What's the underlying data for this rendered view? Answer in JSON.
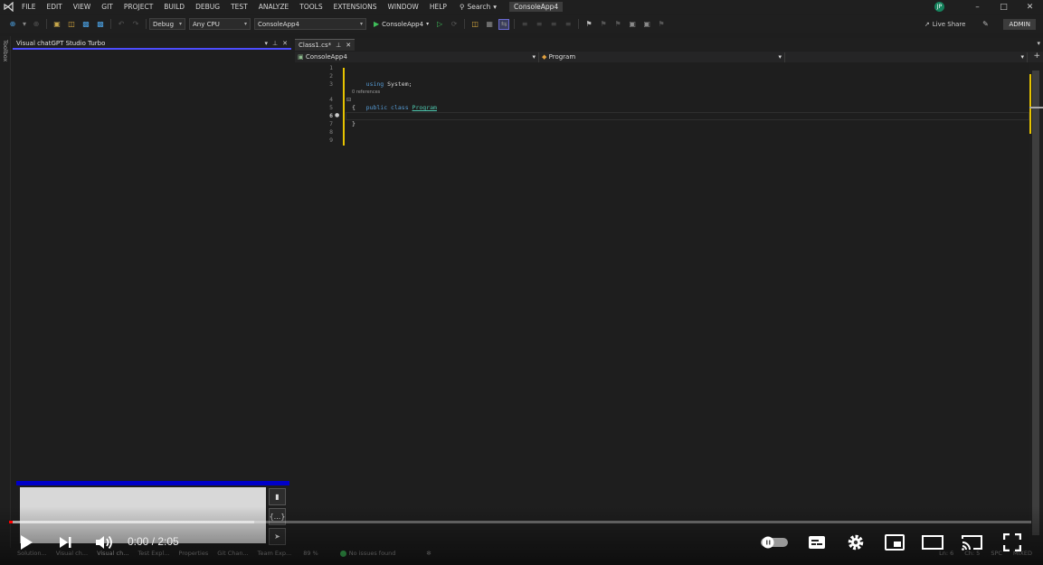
{
  "menu": {
    "items": [
      "FILE",
      "EDIT",
      "VIEW",
      "GIT",
      "PROJECT",
      "BUILD",
      "DEBUG",
      "TEST",
      "ANALYZE",
      "TOOLS",
      "EXTENSIONS",
      "WINDOW",
      "HELP"
    ],
    "search_label": "Search",
    "solution_title": "ConsoleApp4",
    "user_initials": "JP"
  },
  "toolbar": {
    "config": "Debug",
    "platform": "Any CPU",
    "project": "ConsoleApp4",
    "run_label": "ConsoleApp4",
    "live_share": "Live Share",
    "admin": "ADMIN"
  },
  "toolbox": {
    "label": "Toolbox"
  },
  "tool_window": {
    "title": "Visual chatGPT Studio Turbo",
    "buttons": {
      "delete": "trash-icon",
      "format": "ellipsis-icon",
      "send": "send-icon"
    }
  },
  "editor": {
    "tab_label": "Class1.cs*",
    "nav_project": "ConsoleApp4",
    "nav_member": "Program",
    "line_numbers": [
      "1",
      "2",
      "3",
      "4",
      "5",
      "6",
      "7",
      "8",
      "9"
    ],
    "current_line": "6",
    "codelens": "0 references",
    "code": {
      "using_kw": "using",
      "using_ns": " System;",
      "public_kw": "public",
      "class_kw": " class ",
      "class_name": "Program",
      "open_brace": "{",
      "close_brace": "}"
    }
  },
  "bottom_tabs": [
    "Solution...",
    "Visual ch...",
    "Visual ch...",
    "Test Expl...",
    "Properties",
    "Git Chan...",
    "Team Exp..."
  ],
  "status": {
    "zoom": "89 %",
    "issues": "No issues found",
    "line": "Ln: 6",
    "col": "Ch: 5",
    "spc": "SPC",
    "eol": "MIXED"
  },
  "video": {
    "time": "0:00 / 2:05",
    "progress_fraction": 0.003,
    "buffer_fraction": 0.24
  }
}
